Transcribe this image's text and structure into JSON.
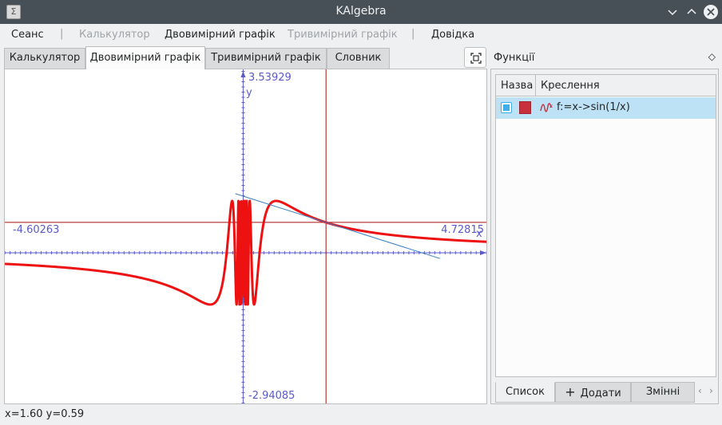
{
  "window": {
    "title": "KAlgebra",
    "controls": [
      "chevron-down-icon",
      "chevron-up-icon",
      "close-icon"
    ]
  },
  "menu": {
    "items": [
      {
        "label": "Сеанс",
        "enabled": true
      },
      {
        "label": "Калькулятор",
        "enabled": false
      },
      {
        "label": "Двовимірний графік",
        "enabled": true
      },
      {
        "label": "Тривимірний графік",
        "enabled": false
      },
      {
        "label": "Довідка",
        "enabled": true
      }
    ],
    "separator": "|"
  },
  "tabs": [
    {
      "label": "Калькулятор",
      "active": false
    },
    {
      "label": "Двовимірний графік",
      "active": true
    },
    {
      "label": "Тривимірний графік",
      "active": false
    },
    {
      "label": "Словник",
      "active": false
    }
  ],
  "plot": {
    "x_min_label": "-4.60263",
    "x_max_label": "4.72815",
    "y_max_label": "3.53929",
    "y_min_label": "-2.94085",
    "x_axis_name": "x",
    "y_axis_name": "y",
    "cursor": {
      "x": 1.6,
      "y": 0.59
    },
    "colors": {
      "curve": "#ee1111",
      "axes": "#5a5ad0",
      "cursor_lines": "#aa1111",
      "tangent": "#3a7fc4",
      "background": "#ffffff"
    }
  },
  "chart_data": {
    "type": "line",
    "series": [
      {
        "name": "f:=x->sin(1/x)",
        "function": "sin(1/x)",
        "color": "#ee1111"
      }
    ],
    "xlim": [
      -4.60263,
      4.72815
    ],
    "ylim": [
      -2.94085,
      3.53929
    ],
    "tangent_at_x": 1.6,
    "xlabel": "x",
    "ylabel": "y"
  },
  "functions_panel": {
    "title": "Функції",
    "columns": [
      "Назва",
      "Креслення"
    ],
    "rows": [
      {
        "name_checked": true,
        "color": "#c9303d",
        "expression": "f:=x->sin(1/x)"
      }
    ],
    "bottom_tabs": [
      {
        "label": "Список",
        "active": true
      },
      {
        "label": "Додати",
        "icon": "plus-icon",
        "active": false
      },
      {
        "label": "Змінні",
        "active": false
      }
    ]
  },
  "status": {
    "text": "x=1.60 y=0.59"
  }
}
